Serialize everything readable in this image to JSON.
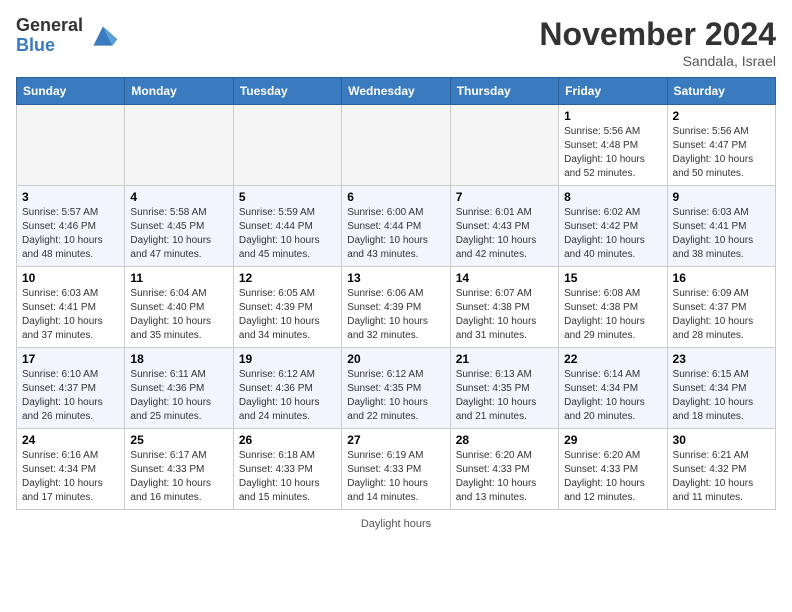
{
  "header": {
    "logo_general": "General",
    "logo_blue": "Blue",
    "month_title": "November 2024",
    "subtitle": "Sandala, Israel"
  },
  "days_of_week": [
    "Sunday",
    "Monday",
    "Tuesday",
    "Wednesday",
    "Thursday",
    "Friday",
    "Saturday"
  ],
  "weeks": [
    [
      {
        "day": "",
        "info": ""
      },
      {
        "day": "",
        "info": ""
      },
      {
        "day": "",
        "info": ""
      },
      {
        "day": "",
        "info": ""
      },
      {
        "day": "",
        "info": ""
      },
      {
        "day": "1",
        "info": "Sunrise: 5:56 AM\nSunset: 4:48 PM\nDaylight: 10 hours and 52 minutes."
      },
      {
        "day": "2",
        "info": "Sunrise: 5:56 AM\nSunset: 4:47 PM\nDaylight: 10 hours and 50 minutes."
      }
    ],
    [
      {
        "day": "3",
        "info": "Sunrise: 5:57 AM\nSunset: 4:46 PM\nDaylight: 10 hours and 48 minutes."
      },
      {
        "day": "4",
        "info": "Sunrise: 5:58 AM\nSunset: 4:45 PM\nDaylight: 10 hours and 47 minutes."
      },
      {
        "day": "5",
        "info": "Sunrise: 5:59 AM\nSunset: 4:44 PM\nDaylight: 10 hours and 45 minutes."
      },
      {
        "day": "6",
        "info": "Sunrise: 6:00 AM\nSunset: 4:44 PM\nDaylight: 10 hours and 43 minutes."
      },
      {
        "day": "7",
        "info": "Sunrise: 6:01 AM\nSunset: 4:43 PM\nDaylight: 10 hours and 42 minutes."
      },
      {
        "day": "8",
        "info": "Sunrise: 6:02 AM\nSunset: 4:42 PM\nDaylight: 10 hours and 40 minutes."
      },
      {
        "day": "9",
        "info": "Sunrise: 6:03 AM\nSunset: 4:41 PM\nDaylight: 10 hours and 38 minutes."
      }
    ],
    [
      {
        "day": "10",
        "info": "Sunrise: 6:03 AM\nSunset: 4:41 PM\nDaylight: 10 hours and 37 minutes."
      },
      {
        "day": "11",
        "info": "Sunrise: 6:04 AM\nSunset: 4:40 PM\nDaylight: 10 hours and 35 minutes."
      },
      {
        "day": "12",
        "info": "Sunrise: 6:05 AM\nSunset: 4:39 PM\nDaylight: 10 hours and 34 minutes."
      },
      {
        "day": "13",
        "info": "Sunrise: 6:06 AM\nSunset: 4:39 PM\nDaylight: 10 hours and 32 minutes."
      },
      {
        "day": "14",
        "info": "Sunrise: 6:07 AM\nSunset: 4:38 PM\nDaylight: 10 hours and 31 minutes."
      },
      {
        "day": "15",
        "info": "Sunrise: 6:08 AM\nSunset: 4:38 PM\nDaylight: 10 hours and 29 minutes."
      },
      {
        "day": "16",
        "info": "Sunrise: 6:09 AM\nSunset: 4:37 PM\nDaylight: 10 hours and 28 minutes."
      }
    ],
    [
      {
        "day": "17",
        "info": "Sunrise: 6:10 AM\nSunset: 4:37 PM\nDaylight: 10 hours and 26 minutes."
      },
      {
        "day": "18",
        "info": "Sunrise: 6:11 AM\nSunset: 4:36 PM\nDaylight: 10 hours and 25 minutes."
      },
      {
        "day": "19",
        "info": "Sunrise: 6:12 AM\nSunset: 4:36 PM\nDaylight: 10 hours and 24 minutes."
      },
      {
        "day": "20",
        "info": "Sunrise: 6:12 AM\nSunset: 4:35 PM\nDaylight: 10 hours and 22 minutes."
      },
      {
        "day": "21",
        "info": "Sunrise: 6:13 AM\nSunset: 4:35 PM\nDaylight: 10 hours and 21 minutes."
      },
      {
        "day": "22",
        "info": "Sunrise: 6:14 AM\nSunset: 4:34 PM\nDaylight: 10 hours and 20 minutes."
      },
      {
        "day": "23",
        "info": "Sunrise: 6:15 AM\nSunset: 4:34 PM\nDaylight: 10 hours and 18 minutes."
      }
    ],
    [
      {
        "day": "24",
        "info": "Sunrise: 6:16 AM\nSunset: 4:34 PM\nDaylight: 10 hours and 17 minutes."
      },
      {
        "day": "25",
        "info": "Sunrise: 6:17 AM\nSunset: 4:33 PM\nDaylight: 10 hours and 16 minutes."
      },
      {
        "day": "26",
        "info": "Sunrise: 6:18 AM\nSunset: 4:33 PM\nDaylight: 10 hours and 15 minutes."
      },
      {
        "day": "27",
        "info": "Sunrise: 6:19 AM\nSunset: 4:33 PM\nDaylight: 10 hours and 14 minutes."
      },
      {
        "day": "28",
        "info": "Sunrise: 6:20 AM\nSunset: 4:33 PM\nDaylight: 10 hours and 13 minutes."
      },
      {
        "day": "29",
        "info": "Sunrise: 6:20 AM\nSunset: 4:33 PM\nDaylight: 10 hours and 12 minutes."
      },
      {
        "day": "30",
        "info": "Sunrise: 6:21 AM\nSunset: 4:32 PM\nDaylight: 10 hours and 11 minutes."
      }
    ]
  ],
  "footer": "Daylight hours"
}
